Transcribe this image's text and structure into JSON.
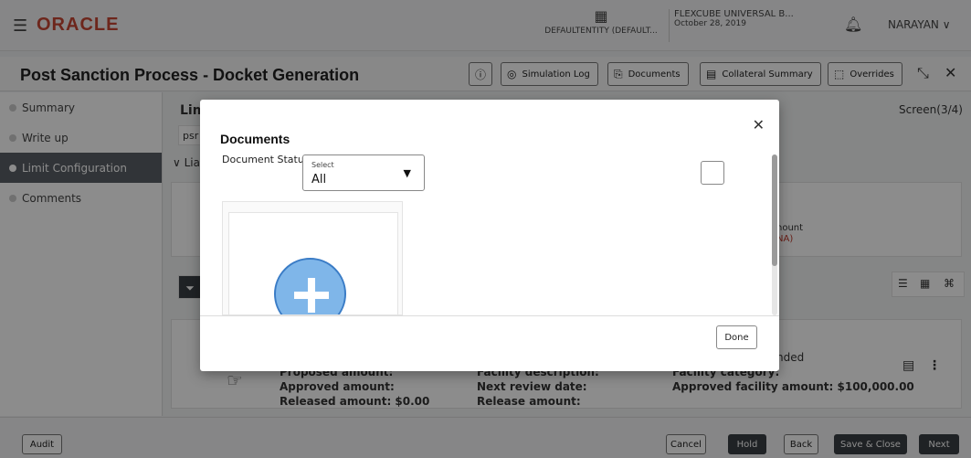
{
  "app": {
    "logo": "ORACLE",
    "entity": "DEFAULTENTITY (DEFAULT...",
    "branch_line1": "FLEXCUBE UNIVERSAL B...",
    "branch_line2": "October 28, 2019",
    "user": "NARAYAN"
  },
  "header": {
    "title": "Post Sanction Process - Docket Generation",
    "buttons": {
      "info": "",
      "simulation": "Simulation Log",
      "documents": "Documents",
      "collateral": "Collateral Summary",
      "overrides": "Overrides"
    }
  },
  "sidebar": {
    "items": [
      {
        "label": "Summary"
      },
      {
        "label": "Write up"
      },
      {
        "label": "Limit Configuration"
      },
      {
        "label": "Comments"
      }
    ]
  },
  "main": {
    "section_title": "Lim",
    "input_value": "psr",
    "subsection": "Lia",
    "screen_indicator": "Screen(3/4)",
    "amount_label": "nount",
    "amount_value": "NA)",
    "card": {
      "status": "nded",
      "proposed": "Proposed amount:",
      "approved": "Approved amount:",
      "released": "Released amount: $0.00",
      "facility_desc": "Facility description:",
      "next_review": "Next review date:",
      "release_amount": "Release amount:",
      "facility_category": "Facility category:",
      "approved_facility": "Approved facility amount: $100,000.00"
    }
  },
  "footer": {
    "audit": "Audit",
    "cancel": "Cancel",
    "hold": "Hold",
    "back": "Back",
    "save_close": "Save & Close",
    "next": "Next"
  },
  "modal": {
    "title": "Documents",
    "status_label": "Document Status",
    "select_caption": "Select",
    "select_value": "All",
    "done": "Done"
  },
  "colors": {
    "brand": "#c74634",
    "active_sidebar": "#5a6066",
    "plus_fill": "#7fb6e9",
    "dark_button": "#3a3f44"
  }
}
